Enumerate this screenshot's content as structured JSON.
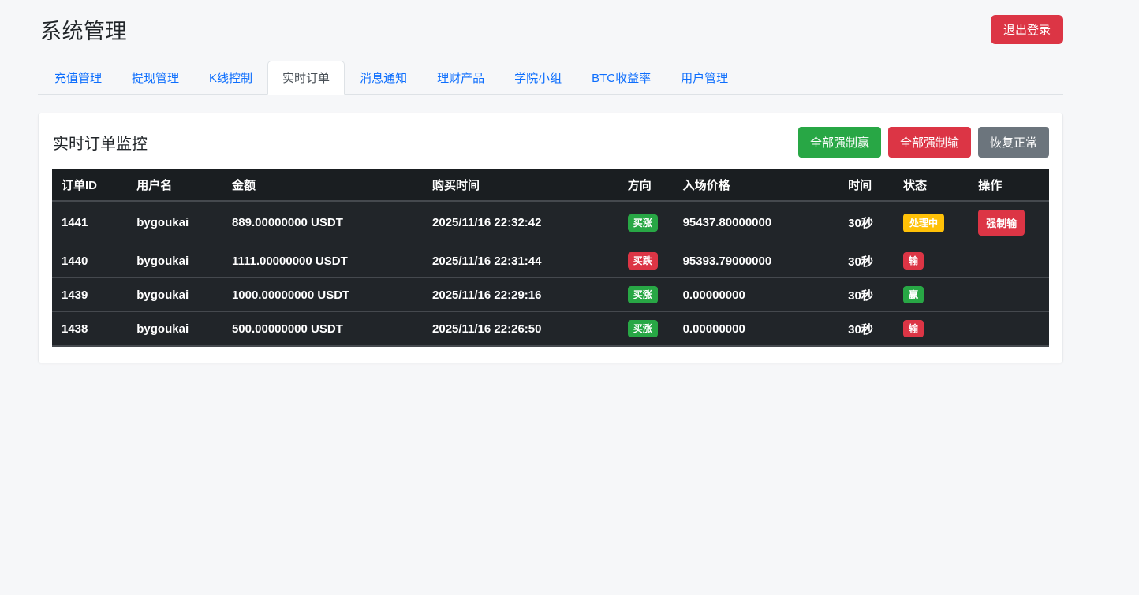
{
  "page_title": "系统管理",
  "header": {
    "logout_label": "退出登录"
  },
  "tabs": [
    {
      "label": "充值管理",
      "active": false
    },
    {
      "label": "提现管理",
      "active": false
    },
    {
      "label": "K线控制",
      "active": false
    },
    {
      "label": "实时订单",
      "active": true
    },
    {
      "label": "消息通知",
      "active": false
    },
    {
      "label": "理财产品",
      "active": false
    },
    {
      "label": "学院小组",
      "active": false
    },
    {
      "label": "BTC收益率",
      "active": false
    },
    {
      "label": "用户管理",
      "active": false
    }
  ],
  "card": {
    "title": "实时订单监控",
    "actions": [
      {
        "label": "全部强制赢",
        "style": "success"
      },
      {
        "label": "全部强制输",
        "style": "danger"
      },
      {
        "label": "恢复正常",
        "style": "secondary"
      }
    ]
  },
  "table": {
    "headers": [
      "订单ID",
      "用户名",
      "金额",
      "购买时间",
      "方向",
      "入场价格",
      "时间",
      "状态",
      "操作"
    ],
    "rows": [
      {
        "order_id": "1441",
        "username": "bygoukai",
        "amount": "889.00000000 USDT",
        "buy_time": "2025/11/16 22:32:42",
        "direction": {
          "label": "买涨",
          "type": "up"
        },
        "entry_price": "95437.80000000",
        "duration": "30秒",
        "status": {
          "label": "处理中",
          "type": "processing"
        },
        "action": {
          "label": "强制输"
        }
      },
      {
        "order_id": "1440",
        "username": "bygoukai",
        "amount": "1111.00000000 USDT",
        "buy_time": "2025/11/16 22:31:44",
        "direction": {
          "label": "买跌",
          "type": "down"
        },
        "entry_price": "95393.79000000",
        "duration": "30秒",
        "status": {
          "label": "输",
          "type": "lose"
        }
      },
      {
        "order_id": "1439",
        "username": "bygoukai",
        "amount": "1000.00000000 USDT",
        "buy_time": "2025/11/16 22:29:16",
        "direction": {
          "label": "买涨",
          "type": "up"
        },
        "entry_price": "0.00000000",
        "duration": "30秒",
        "status": {
          "label": "赢",
          "type": "win"
        }
      },
      {
        "order_id": "1438",
        "username": "bygoukai",
        "amount": "500.00000000 USDT",
        "buy_time": "2025/11/16 22:26:50",
        "direction": {
          "label": "买涨",
          "type": "up"
        },
        "entry_price": "0.00000000",
        "duration": "30秒",
        "status": {
          "label": "输",
          "type": "lose"
        }
      }
    ]
  },
  "colors": {
    "green": "#28a745",
    "red": "#dc3545",
    "gray": "#6c757d",
    "yellow": "#ffc107",
    "link_blue": "#0d6efd",
    "table_dark": "#212529",
    "table_header_dark": "#1a1e21",
    "table_border": "#45494e"
  }
}
